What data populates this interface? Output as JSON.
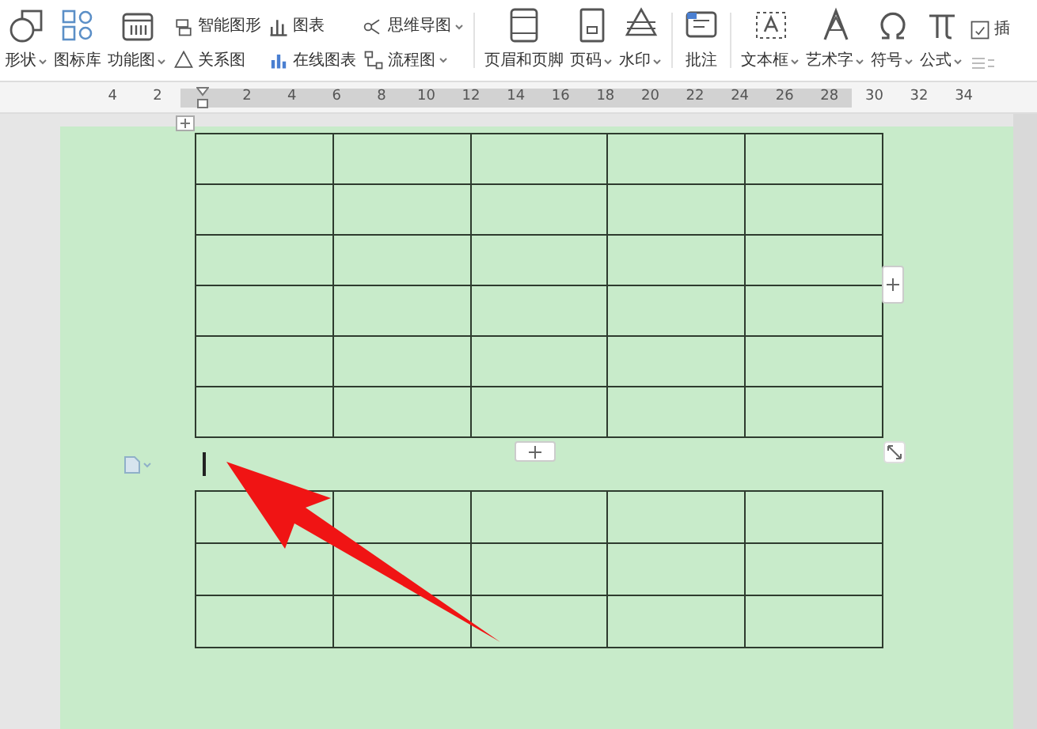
{
  "toolbar": [
    {
      "kind": "large",
      "label": "形状",
      "dropdown": true
    },
    {
      "kind": "large",
      "label": "图标库",
      "dropdown": false
    },
    {
      "kind": "large",
      "label": "功能图",
      "dropdown": true
    },
    {
      "kind": "pair",
      "items": [
        {
          "label": "智能图形",
          "dropdown": false
        },
        {
          "label": "关系图",
          "dropdown": false
        }
      ]
    },
    {
      "kind": "pair",
      "items": [
        {
          "label": "图表",
          "dropdown": false
        },
        {
          "label": "在线图表",
          "dropdown": false
        }
      ]
    },
    {
      "kind": "pair",
      "items": [
        {
          "label": "思维导图",
          "dropdown": true
        },
        {
          "label": "流程图",
          "dropdown": true
        }
      ]
    },
    {
      "kind": "separator"
    },
    {
      "kind": "large",
      "label": "页眉和页脚",
      "dropdown": false
    },
    {
      "kind": "large",
      "label": "页码",
      "dropdown": true
    },
    {
      "kind": "large",
      "label": "水印",
      "dropdown": true
    },
    {
      "kind": "separator"
    },
    {
      "kind": "large",
      "label": "批注",
      "dropdown": false
    },
    {
      "kind": "separator"
    },
    {
      "kind": "large",
      "label": "文本框",
      "dropdown": true
    },
    {
      "kind": "large",
      "label": "艺术字",
      "dropdown": true
    },
    {
      "kind": "large",
      "label": "符号",
      "dropdown": true
    },
    {
      "kind": "large",
      "label": "公式",
      "dropdown": true
    },
    {
      "kind": "partial",
      "label": "插"
    }
  ],
  "ruler": {
    "left_labels": [
      "4",
      "2"
    ],
    "body_labels": [
      "2",
      "4",
      "6",
      "8",
      "10",
      "12",
      "14",
      "16",
      "18",
      "20",
      "22",
      "24",
      "26",
      "28"
    ],
    "right_labels": [
      "30",
      "32",
      "34"
    ]
  }
}
